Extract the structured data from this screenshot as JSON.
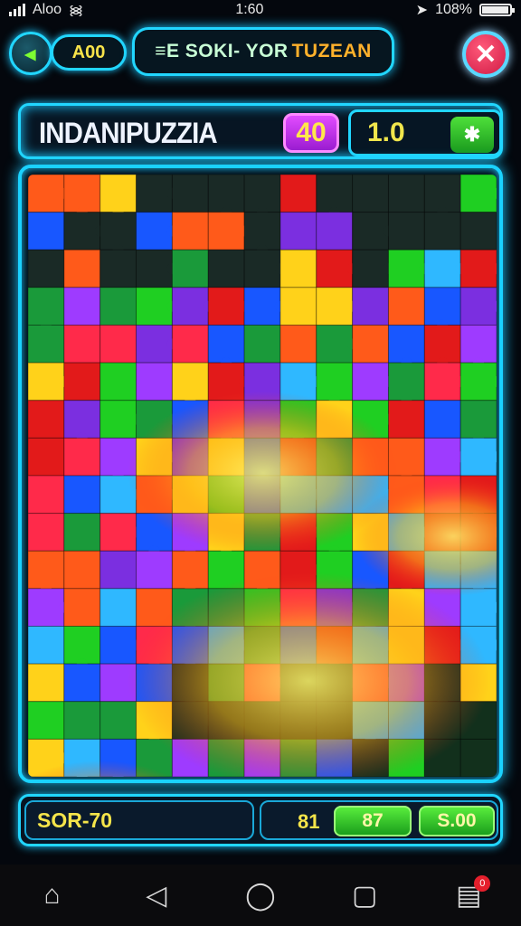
{
  "status_bar": {
    "carrier": "Aloo",
    "time": "1:60",
    "battery": "108%"
  },
  "top_bar": {
    "coins": "A00",
    "title_part1": "≡E SOKI- YOR",
    "title_part2": "TUZEAN"
  },
  "info_bar": {
    "puzzle_name": "INDANIPUZZIA",
    "level": "40",
    "score": "1.0"
  },
  "bottom_bar": {
    "left_stat": "SOR-70",
    "right_stat": "81",
    "button_a": "87",
    "button_b": "S.00"
  },
  "nav": {
    "badge": "0"
  },
  "colors": {
    "accent_neon": "#1ad2ff",
    "board_palette": [
      "#2fb8ff",
      "#e21a1a",
      "#1fcf22",
      "#9e3bff",
      "#ff5a1a",
      "#ffd21a",
      "#1857ff",
      "#1a9a3a",
      "#7b2fe0",
      "#ff2a4a"
    ]
  },
  "icons": [
    "signal-bars-icon",
    "wifi-icon",
    "location-icon",
    "battery-icon",
    "back-arrow-icon",
    "close-icon",
    "puzzle-hint-icon",
    "home-icon",
    "back-triangle-icon",
    "circle-home-icon",
    "square-recents-icon",
    "chart-notification-icon"
  ]
}
